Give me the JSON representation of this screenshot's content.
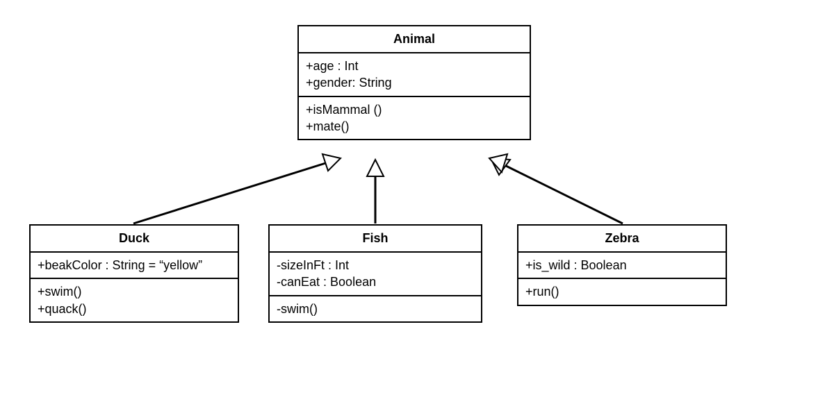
{
  "diagram": {
    "type": "uml-class-diagram",
    "classes": {
      "animal": {
        "name": "Animal",
        "attributes": [
          "+age : Int",
          "+gender: String"
        ],
        "methods": [
          "+isMammal ()",
          "+mate()"
        ]
      },
      "duck": {
        "name": "Duck",
        "attributes": [
          "+beakColor : String = “yellow”"
        ],
        "methods": [
          "+swim()",
          "+quack()"
        ]
      },
      "fish": {
        "name": "Fish",
        "attributes": [
          "-sizeInFt : Int",
          "-canEat : Boolean"
        ],
        "methods": [
          "-swim()"
        ]
      },
      "zebra": {
        "name": "Zebra",
        "attributes": [
          "+is_wild : Boolean"
        ],
        "methods": [
          "+run()"
        ]
      }
    },
    "relationships": [
      {
        "from": "duck",
        "to": "animal",
        "type": "inheritance"
      },
      {
        "from": "fish",
        "to": "animal",
        "type": "inheritance"
      },
      {
        "from": "zebra",
        "to": "animal",
        "type": "inheritance"
      }
    ]
  }
}
